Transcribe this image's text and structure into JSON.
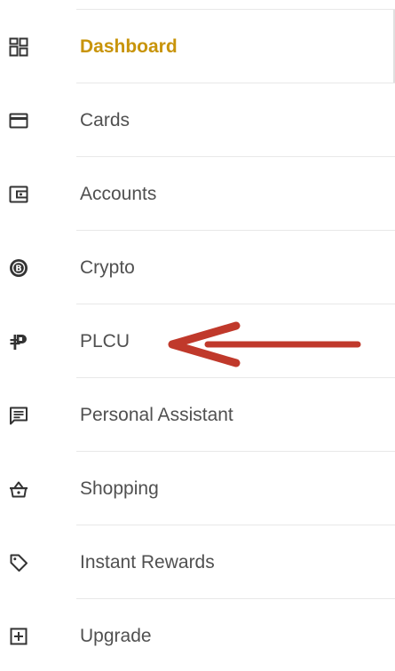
{
  "nav": {
    "items": [
      {
        "label": "Dashboard",
        "icon": "dashboard-icon",
        "active": true
      },
      {
        "label": "Cards",
        "icon": "card-icon",
        "active": false
      },
      {
        "label": "Accounts",
        "icon": "wallet-icon",
        "active": false
      },
      {
        "label": "Crypto",
        "icon": "bitcoin-icon",
        "active": false
      },
      {
        "label": "PLCU",
        "icon": "plcu-icon",
        "active": false
      },
      {
        "label": "Personal Assistant",
        "icon": "chat-icon",
        "active": false
      },
      {
        "label": "Shopping",
        "icon": "basket-icon",
        "active": false
      },
      {
        "label": "Instant Rewards",
        "icon": "tag-icon",
        "active": false
      },
      {
        "label": "Upgrade",
        "icon": "plus-box-icon",
        "active": false
      }
    ]
  },
  "colors": {
    "active_text": "#c8940a",
    "text": "#505050",
    "icon": "#333333",
    "annotation_arrow": "#c0392b"
  }
}
